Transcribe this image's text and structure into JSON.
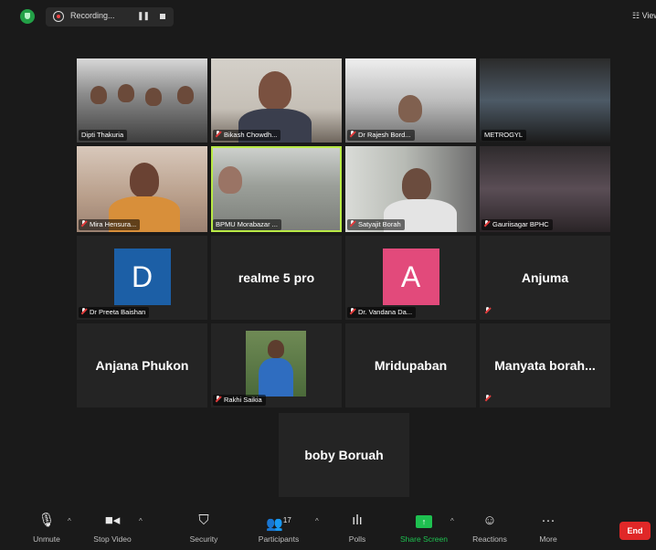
{
  "topbar": {
    "recording_label": "Recording...",
    "pause_icon": "pause-icon",
    "stop_icon": "stop-icon",
    "view_label": "View"
  },
  "video_tiles": [
    {
      "name": "Dipti Thakuria"
    },
    {
      "name": "Bikash Chowdh..."
    },
    {
      "name": "Dr Rajesh Bord..."
    },
    {
      "name": "METROGYL"
    },
    {
      "name": "Mira Hensura..."
    },
    {
      "name": "BPMU Morabazar ..."
    },
    {
      "name": "Satyajit Borah"
    },
    {
      "name": "Gauriisagar BPHC"
    }
  ],
  "name_tiles": [
    {
      "avatar_letter": "D",
      "avatar_color": "#1c5fa6",
      "name": "Dr Preeta Baishan"
    },
    {
      "big_name": "realme 5 pro"
    },
    {
      "avatar_letter": "A",
      "avatar_color": "#e24a7b",
      "name": "Dr. Vandana Da..."
    },
    {
      "big_name": "Anjuma"
    },
    {
      "big_name": "Anjana Phukon"
    },
    {
      "name": "Rakhi Saikia"
    },
    {
      "big_name": "Mridupaban"
    },
    {
      "big_name": "Manyata  borah..."
    },
    {
      "big_name": "boby Boruah"
    }
  ],
  "toolbar": {
    "unmute": "Unmute",
    "stop_video": "Stop Video",
    "security": "Security",
    "participants": "Participants",
    "participants_count": "17",
    "polls": "Polls",
    "share_screen": "Share Screen",
    "reactions": "Reactions",
    "more": "More",
    "end": "End"
  }
}
